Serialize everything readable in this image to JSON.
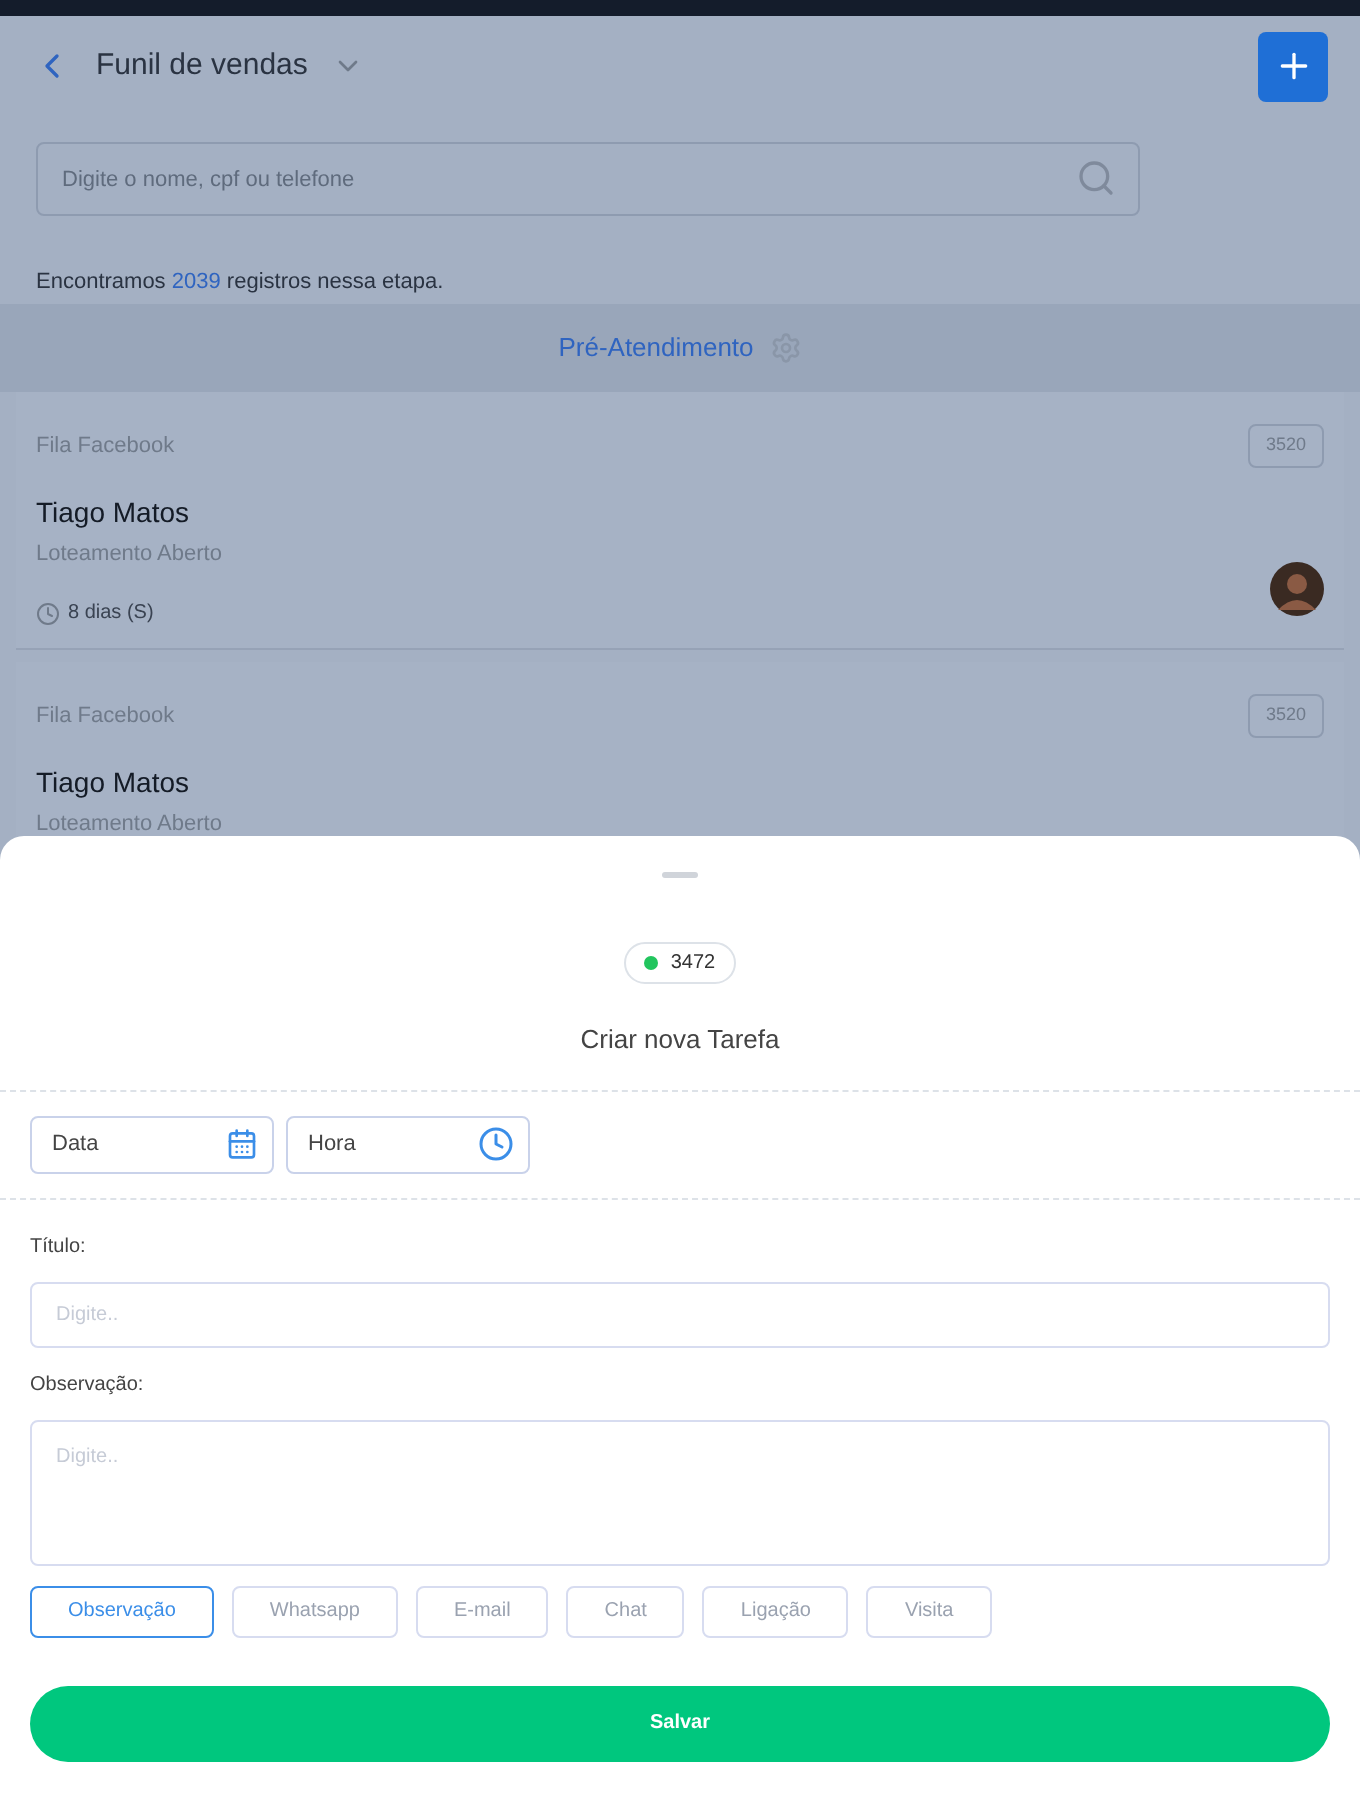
{
  "header": {
    "title": "Funil de vendas"
  },
  "search": {
    "placeholder": "Digite o nome, cpf ou telefone"
  },
  "summary": {
    "text": "Encontramos **2039** registros nessa etapa."
  },
  "stage": {
    "title": "Pré-Atendimento"
  },
  "cards": [
    {
      "queue": "Fila Facebook",
      "code": "3520",
      "name": "Tiago Matos",
      "project": "Loteamento Aberto",
      "age": "8 dias (S)",
      "avatar": true
    },
    {
      "queue": "Fila Facebook",
      "code": "3520",
      "name": "Tiago Matos",
      "project": "Loteamento Aberto",
      "avatar": false
    }
  ],
  "sheet": {
    "badge": {
      "text": "3472",
      "color": "#22c55e"
    },
    "title": "Criar nova Tarefa",
    "date_field": {
      "placeholder": "Data"
    },
    "time_field": {
      "placeholder": "Hora"
    },
    "title_label": "Título:",
    "title_field": {
      "placeholder": "Digite.."
    },
    "note_label": "Observação:",
    "note_field": {
      "placeholder": "Digite.."
    },
    "types": [
      {
        "label": "Observação",
        "selected": true
      },
      {
        "label": "Whatsapp",
        "selected": false
      },
      {
        "label": "E-mail",
        "selected": false
      },
      {
        "label": "Chat",
        "selected": false
      },
      {
        "label": "Ligação",
        "selected": false
      },
      {
        "label": "Visita",
        "selected": false
      }
    ],
    "save": "Salvar"
  }
}
